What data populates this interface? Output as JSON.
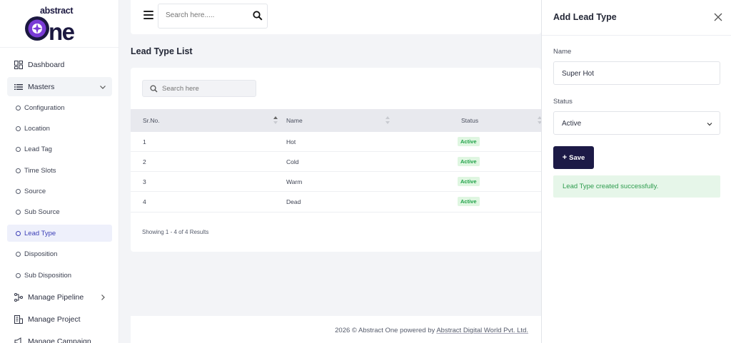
{
  "brand": {
    "logo_top": "abstract",
    "logo_main": "one",
    "accent": "#7a3bd6",
    "primary": "#1c1a46"
  },
  "topbar": {
    "search_placeholder": "Search here....."
  },
  "sidebar": {
    "dashboard": "Dashboard",
    "masters": "Masters",
    "sub_items": [
      "Configuration",
      "Location",
      "Lead Tag",
      "Time Slots",
      "Source",
      "Sub Source",
      "Lead Type",
      "Disposition",
      "Sub Disposition"
    ],
    "active_sub_item": "Lead Type",
    "manage_pipeline": "Manage Pipeline",
    "manage_project": "Manage Project",
    "manage_campaign": "Manage Campaign"
  },
  "list": {
    "title": "Lead Type List",
    "search_placeholder": "Search here",
    "columns": [
      "Sr.No.",
      "Name",
      "Status"
    ],
    "rows": [
      {
        "sr": "1",
        "name": "Hot",
        "status": "Active"
      },
      {
        "sr": "2",
        "name": "Cold",
        "status": "Active"
      },
      {
        "sr": "3",
        "name": "Warm",
        "status": "Active"
      },
      {
        "sr": "4",
        "name": "Dead",
        "status": "Active"
      }
    ],
    "showing": "Showing 1 - 4 of 4 Results"
  },
  "footer": {
    "text": "2026 © Abstract One powered by ",
    "link": "Abstract Digital World Pvt. Ltd."
  },
  "panel": {
    "title": "Add Lead Type",
    "name_label": "Name",
    "name_value": "Super Hot",
    "status_label": "Status",
    "status_value": "Active",
    "save_label": "Save",
    "alert_text": "Lead Type created successfully."
  }
}
